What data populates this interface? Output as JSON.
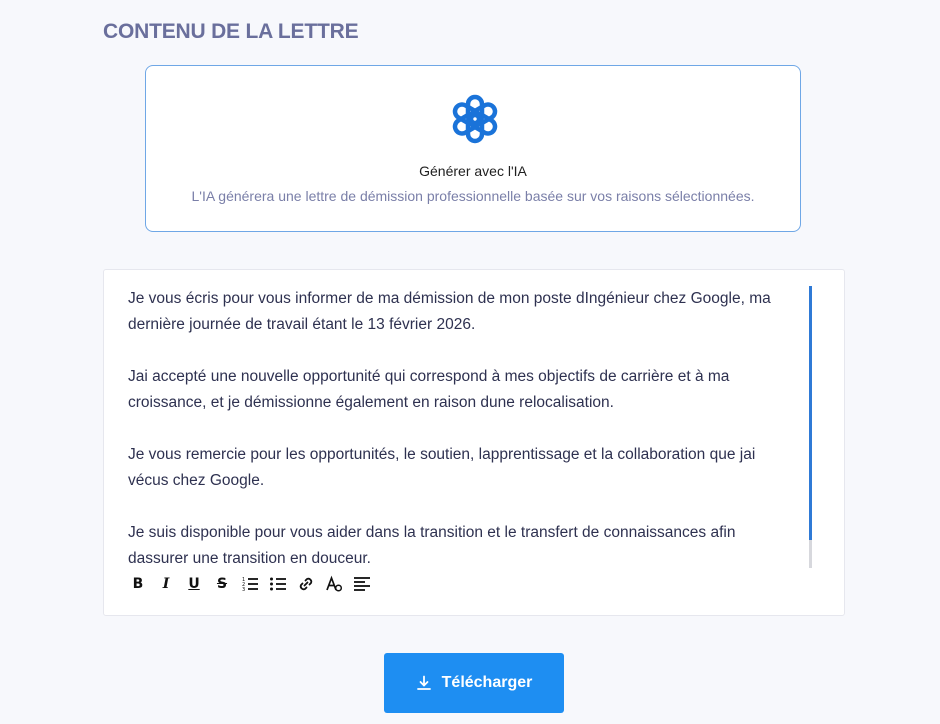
{
  "section": {
    "title": "CONTENU DE LA LETTRE"
  },
  "ai_card": {
    "icon": "openai-logo-icon",
    "title": "Générer avec l'IA",
    "subtitle": "L'IA générera une lettre de démission professionnelle basée sur vos raisons sélectionnées."
  },
  "editor": {
    "paragraphs": [
      "Je vous écris pour vous informer de ma démission de mon poste dIngénieur chez Google, ma dernière journée de travail étant le 13 février 2026.",
      "Jai accepté une nouvelle opportunité qui correspond à mes objectifs de carrière et à ma croissance, et je démissionne également en raison dune relocalisation.",
      "Je vous remercie pour les opportunités, le soutien, lapprentissage et la collaboration que jai vécus chez Google.",
      "Je suis disponible pour vous aider dans la transition et le transfert de connaissances afin dassurer une transition en douceur."
    ],
    "toolbar": {
      "bold": "B",
      "italic": "I",
      "underline": "U",
      "strike": "S",
      "icons": [
        "bold-icon",
        "italic-icon",
        "underline-icon",
        "strikethrough-icon",
        "ordered-list-icon",
        "bullet-list-icon",
        "link-icon",
        "clear-format-icon",
        "align-left-icon"
      ]
    }
  },
  "download": {
    "label": "Télécharger",
    "icon": "download-icon"
  },
  "colors": {
    "accent": "#1e8ef2",
    "title": "#6a6f9c",
    "card_border": "#6fa7e6",
    "logo": "#1a73d9",
    "scroll_thumb": "#2f7ad6"
  }
}
